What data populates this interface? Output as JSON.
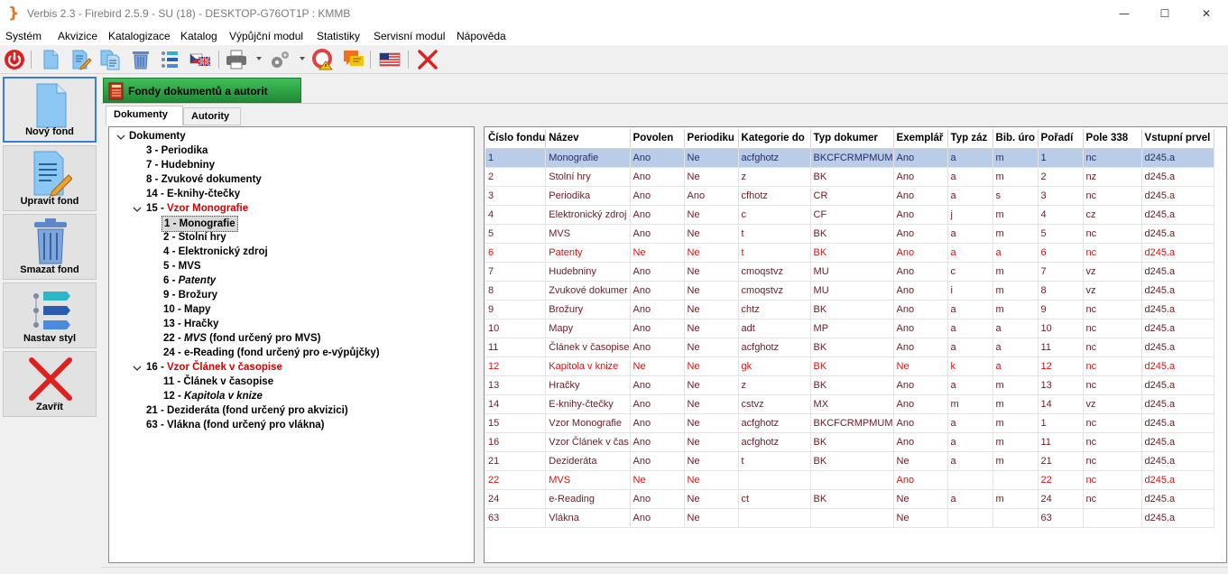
{
  "window": {
    "title": "Verbis 2.3 - Firebird 2.5.9 - SU (18) - DESKTOP-G76OT1P : KMMB",
    "minimize_glyph": "—",
    "maximize_glyph": "☐",
    "close_glyph": "✕"
  },
  "menu": [
    "Systém",
    "Akvizice",
    "Katalogizace",
    "Katalog",
    "Výpůjční modul",
    "Statistiky",
    "Servisní modul",
    "Nápověda"
  ],
  "toolbar_icons": [
    "power-icon",
    "new-document-icon",
    "edit-document-icon",
    "copy-documents-icon",
    "trash-icon",
    "style-icon",
    "language-flags-icon",
    "printer-icon",
    "settings-icon",
    "help-warning-icon",
    "messages-icon",
    "us-flag-icon",
    "close-x-icon"
  ],
  "sidebar": {
    "buttons": [
      {
        "label": "Nový fond"
      },
      {
        "label": "Upravit fond"
      },
      {
        "label": "Smazat fond"
      },
      {
        "label": "Nastav styl"
      },
      {
        "label": "Zavřít"
      }
    ]
  },
  "main_tab": {
    "label": "Fondy dokumentů a autorit"
  },
  "sub_tabs": {
    "documents": "Dokumenty",
    "authorities": "Autority"
  },
  "tree": {
    "root": "Dokumenty",
    "nodes": [
      "3 - Periodika",
      "7 - Hudebniny",
      "8 - Zvukové dokumenty",
      "14 - E-knihy-čtečky",
      "15 - ",
      "Vzor Monografie",
      "1 - Monografie",
      "2 - Stolní hry",
      "4 - Elektronický zdroj",
      "5 - MVS",
      "6 - ",
      "Patenty",
      "9 - Brožury",
      "10 - Mapy",
      "13 - Hračky",
      "22 - ",
      "MVS",
      " (fond určený pro MVS)",
      "24 - e-Reading (fond určený pro e-výpůjčky)",
      "16 - ",
      "Vzor Článek v časopise",
      "11 - Článek v časopise",
      "12 - ",
      "Kapitola v knize",
      "21 - Dezideráta (fond určený pro akvizici)",
      "63 - Vlákna (fond určený pro vlákna)"
    ]
  },
  "table": {
    "columns": [
      "Číslo fondu",
      "Název",
      "Povolen",
      "Periodiku",
      "Kategorie do",
      "Typ dokumer",
      "Exemplář",
      "Typ záz",
      "Bib. úro",
      "Pořadí",
      "Pole 338",
      "Vstupní prvel"
    ],
    "rows": [
      [
        "1",
        "Monografie",
        "Ano",
        "Ne",
        "acfghotz",
        "BKCFCRMPMUM",
        "Ano",
        "a",
        "m",
        "1",
        "nc",
        "d245.a"
      ],
      [
        "2",
        "Stolní hry",
        "Ano",
        "Ne",
        "z",
        "BK",
        "Ano",
        "a",
        "m",
        "2",
        "nz",
        "d245.a"
      ],
      [
        "3",
        "Periodika",
        "Ano",
        "Ano",
        "cfhotz",
        "CR",
        "Ano",
        "a",
        "s",
        "3",
        "nc",
        "d245.a"
      ],
      [
        "4",
        "Elektronický zdroj",
        "Ano",
        "Ne",
        "c",
        "CF",
        "Ano",
        "j",
        "m",
        "4",
        "cz",
        "d245.a"
      ],
      [
        "5",
        "MVS",
        "Ano",
        "Ne",
        "t",
        "BK",
        "Ano",
        "a",
        "m",
        "5",
        "nc",
        "d245.a"
      ],
      [
        "6",
        "Patenty",
        "Ne",
        "Ne",
        "t",
        "BK",
        "Ano",
        "a",
        "a",
        "6",
        "nc",
        "d245.a"
      ],
      [
        "7",
        "Hudebniny",
        "Ano",
        "Ne",
        "cmoqstvz",
        "MU",
        "Ano",
        "c",
        "m",
        "7",
        "vz",
        "d245.a"
      ],
      [
        "8",
        "Zvukové dokumer",
        "Ano",
        "Ne",
        "cmoqstvz",
        "MU",
        "Ano",
        "i",
        "m",
        "8",
        "vz",
        "d245.a"
      ],
      [
        "9",
        "Brožury",
        "Ano",
        "Ne",
        "chtz",
        "BK",
        "Ano",
        "a",
        "m",
        "9",
        "nc",
        "d245.a"
      ],
      [
        "10",
        "Mapy",
        "Ano",
        "Ne",
        "adt",
        "MP",
        "Ano",
        "a",
        "a",
        "10",
        "nc",
        "d245.a"
      ],
      [
        "11",
        "Článek v časopise",
        "Ano",
        "Ne",
        "acfghotz",
        "BK",
        "Ano",
        "a",
        "a",
        "11",
        "nc",
        "d245.a"
      ],
      [
        "12",
        "Kapitola v knize",
        "Ne",
        "Ne",
        "gk",
        "BK",
        "Ne",
        "k",
        "a",
        "12",
        "nc",
        "d245.a"
      ],
      [
        "13",
        "Hračky",
        "Ano",
        "Ne",
        "z",
        "BK",
        "Ano",
        "a",
        "m",
        "13",
        "nc",
        "d245.a"
      ],
      [
        "14",
        "E-knihy-čtečky",
        "Ano",
        "Ne",
        "cstvz",
        "MX",
        "Ano",
        "m",
        "m",
        "14",
        "vz",
        "d245.a"
      ],
      [
        "15",
        "Vzor Monografie",
        "Ano",
        "Ne",
        "acfghotz",
        "BKCFCRMPMUM",
        "Ano",
        "a",
        "m",
        "1",
        "nc",
        "d245.a"
      ],
      [
        "16",
        "Vzor Článek v čas",
        "Ano",
        "Ne",
        "acfghotz",
        "BK",
        "Ano",
        "a",
        "m",
        "11",
        "nc",
        "d245.a"
      ],
      [
        "21",
        "Dezideráta",
        "Ano",
        "Ne",
        "t",
        "BK",
        "Ne",
        "a",
        "m",
        "21",
        "nc",
        "d245.a"
      ],
      [
        "22",
        "MVS",
        "Ne",
        "Ne",
        "",
        "",
        "Ano",
        "",
        "",
        "22",
        "nc",
        "d245.a"
      ],
      [
        "24",
        "e-Reading",
        "Ano",
        "Ne",
        "ct",
        "BK",
        "Ne",
        "a",
        "m",
        "24",
        "nc",
        "d245.a"
      ],
      [
        "63",
        "Vlákna",
        "Ano",
        "Ne",
        "",
        "",
        "Ne",
        "",
        "",
        "63",
        "",
        "d245.a"
      ]
    ],
    "selected_row": 0,
    "red_rows": [
      5,
      11,
      17
    ]
  },
  "colors": {
    "accent_green": "#1f8a34",
    "selection": "#b9cde9",
    "red_text": "#d60000",
    "dark_text": "#6b1a22"
  }
}
